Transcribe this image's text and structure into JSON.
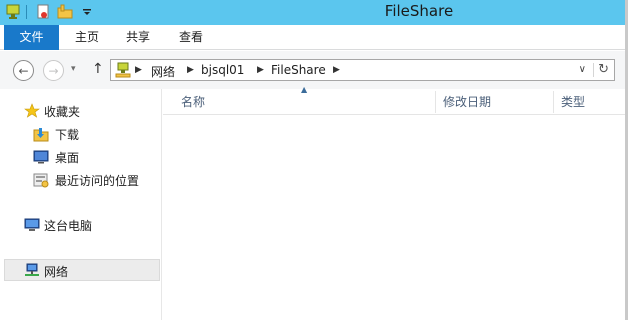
{
  "window": {
    "title": "FileShare"
  },
  "quick_access": {
    "icons": [
      "computer-icon",
      "properties-icon",
      "new-folder-icon",
      "customize-dropdown-icon"
    ]
  },
  "ribbon": {
    "tabs": [
      {
        "label": "文件",
        "active": true
      },
      {
        "label": "主页"
      },
      {
        "label": "共享"
      },
      {
        "label": "查看"
      }
    ],
    "accent": "#1979ca",
    "titlebar_color": "#5bc6ee"
  },
  "navigation": {
    "back": "←",
    "forward": "→",
    "recent": "▾",
    "up": "↑"
  },
  "address": {
    "crumbs": [
      "网络",
      "bjsql01",
      "FileShare"
    ],
    "dropdown": "∨",
    "refresh": "↻"
  },
  "sidebar": {
    "favorites_label": "收藏夹",
    "items": [
      {
        "label": "下载",
        "icon": "download-folder-icon"
      },
      {
        "label": "桌面",
        "icon": "desktop-icon"
      },
      {
        "label": "最近访问的位置",
        "icon": "recent-places-icon"
      }
    ],
    "this_pc_label": "这台电脑",
    "network_label": "网络"
  },
  "columns": {
    "name": "名称",
    "modified": "修改日期",
    "type": "类型"
  }
}
